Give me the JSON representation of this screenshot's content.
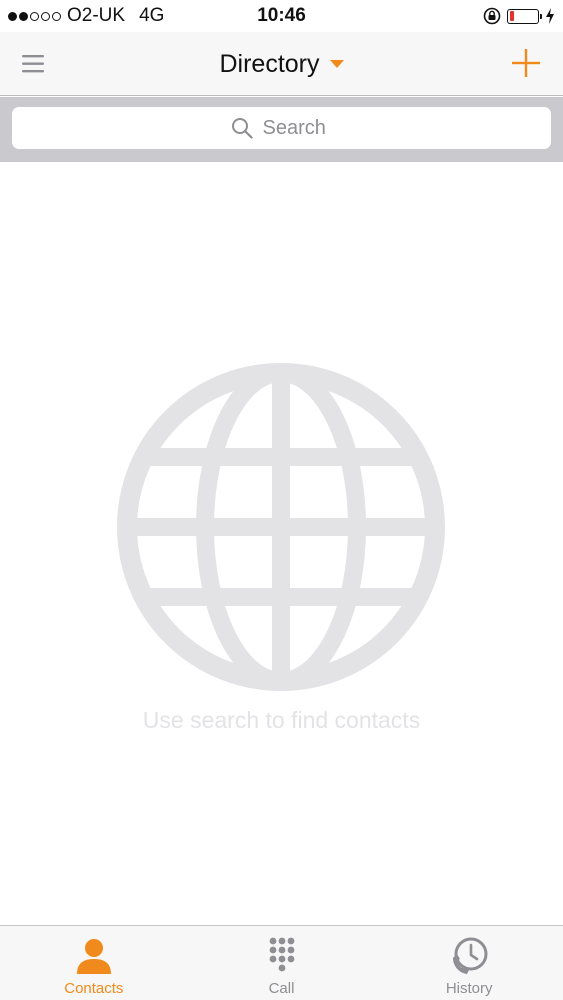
{
  "status_bar": {
    "signal_bars_filled": 2,
    "signal_bars_total": 5,
    "carrier": "O2-UK",
    "network": "4G",
    "time": "10:46",
    "battery_level": 0.15,
    "battery_color": "#e5322d"
  },
  "nav": {
    "title": "Directory",
    "accent_color": "#f08a1c",
    "left_icon": "hamburger-menu-icon",
    "right_icon": "plus-icon"
  },
  "search": {
    "placeholder": "Search"
  },
  "empty_state": {
    "icon": "globe-icon",
    "message": "Use search to find contacts"
  },
  "tabs": [
    {
      "label": "Contacts",
      "icon": "person-icon",
      "active": true
    },
    {
      "label": "Call",
      "icon": "dialpad-icon",
      "active": false
    },
    {
      "label": "History",
      "icon": "clock-phone-icon",
      "active": false
    }
  ]
}
